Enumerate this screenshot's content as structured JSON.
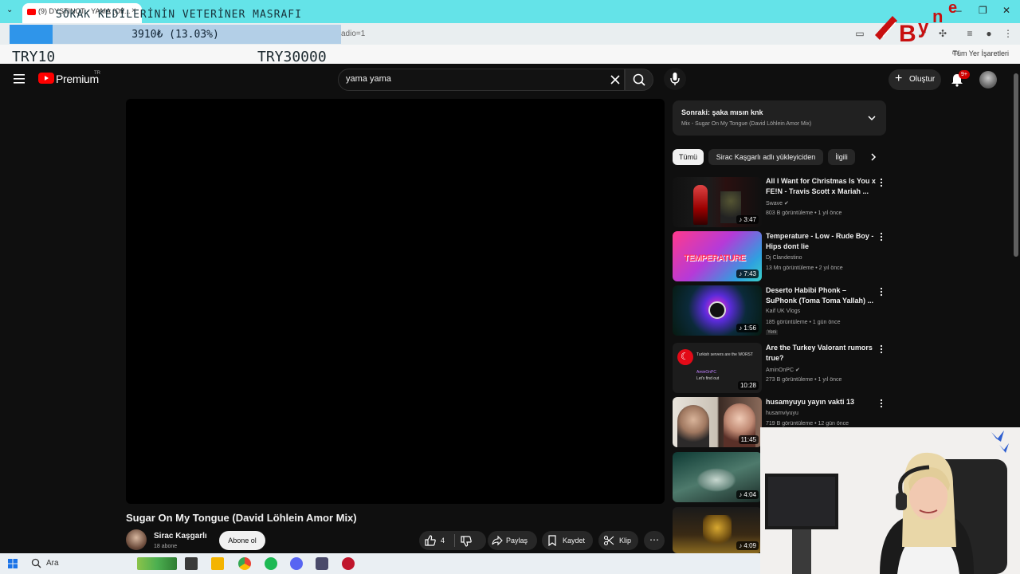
{
  "browser": {
    "tab_title": "(9) DYSTINCT - YAMA (Off...",
    "tab_close": "×",
    "url_fragment": "adio=1",
    "all_bookmarks": "Tüm Yer İşaretleri"
  },
  "overlay": {
    "title": "SOKAK KEDİLERİNİN VETERİNER MASRAFI",
    "goal_text": "3910₺ (13.03%)",
    "goal_progress": 0.1303,
    "goal_min": "TRY10",
    "goal_max": "TRY30000"
  },
  "masthead": {
    "logo_text": "Premium",
    "logo_region": "TR",
    "search_value": "yama yama",
    "create_label": "Oluştur",
    "notification_badge": "9+"
  },
  "video": {
    "title": "Sugar On My Tongue (David Löhlein Amor Mix)",
    "channel": "Sirac Kaşgarlı",
    "subscribers": "18 abone",
    "subscribe_label": "Abone ol",
    "like_count": "4",
    "share_label": "Paylaş",
    "save_label": "Kaydet",
    "clip_label": "Klip"
  },
  "up_next": {
    "title": "Sonraki: şaka mısın knk",
    "subtitle": "Mix - Sugar On My Tongue (David Löhlein Amor Mix)"
  },
  "chips": [
    "Tümü",
    "Sirac Kaşgarlı adlı yükleyiciden",
    "İlgili"
  ],
  "recommendations": [
    {
      "title": "All I Want for Christmas Is You x FE!N - Travis Scott x Mariah ...",
      "channel": "Swave",
      "meta": "803 B görüntüleme • 1 yıl önce",
      "duration": "♪ 3:47",
      "verified": true
    },
    {
      "title": "Temperature - Low - Rude Boy - Hips dont lie",
      "channel": "Dj Clandestino",
      "meta": "13 Mn görüntüleme • 2 yıl önce",
      "duration": "♪ 7:43",
      "thumb_text": "TEMPERATURE"
    },
    {
      "title": "Deserto Habibi Phonk – SuPhonk (Toma Toma Yallah) ...",
      "channel": "Kaif UK Vlogs",
      "meta": "185 görüntüleme • 1 gün önce",
      "duration": "♪ 1:56",
      "badge": "Yeni"
    },
    {
      "title": "Are the Turkey Valorant rumors true?",
      "channel": "AminOnPC",
      "meta": "273 B görüntüleme • 1 yıl önce",
      "duration": "10:28",
      "verified": true,
      "thumb_lines": [
        "Turkish servers are the WORST",
        "AminOnPC",
        "Let's find out"
      ]
    },
    {
      "title": "husamyuyu yayın vakti 13",
      "channel": "husamviyuyu",
      "meta": "719 B görüntüleme • 12 gün önce",
      "duration": "11:45"
    },
    {
      "duration": "♪ 4:04"
    },
    {
      "duration": "♪ 4:09"
    }
  ],
  "taskbar": {
    "search_label": "Ara"
  },
  "colors": {
    "accent_red": "#ff0000",
    "bg": "#0f0f0f",
    "tab_bar": "#64e3e8",
    "goal_fill": "#2f95ea"
  }
}
